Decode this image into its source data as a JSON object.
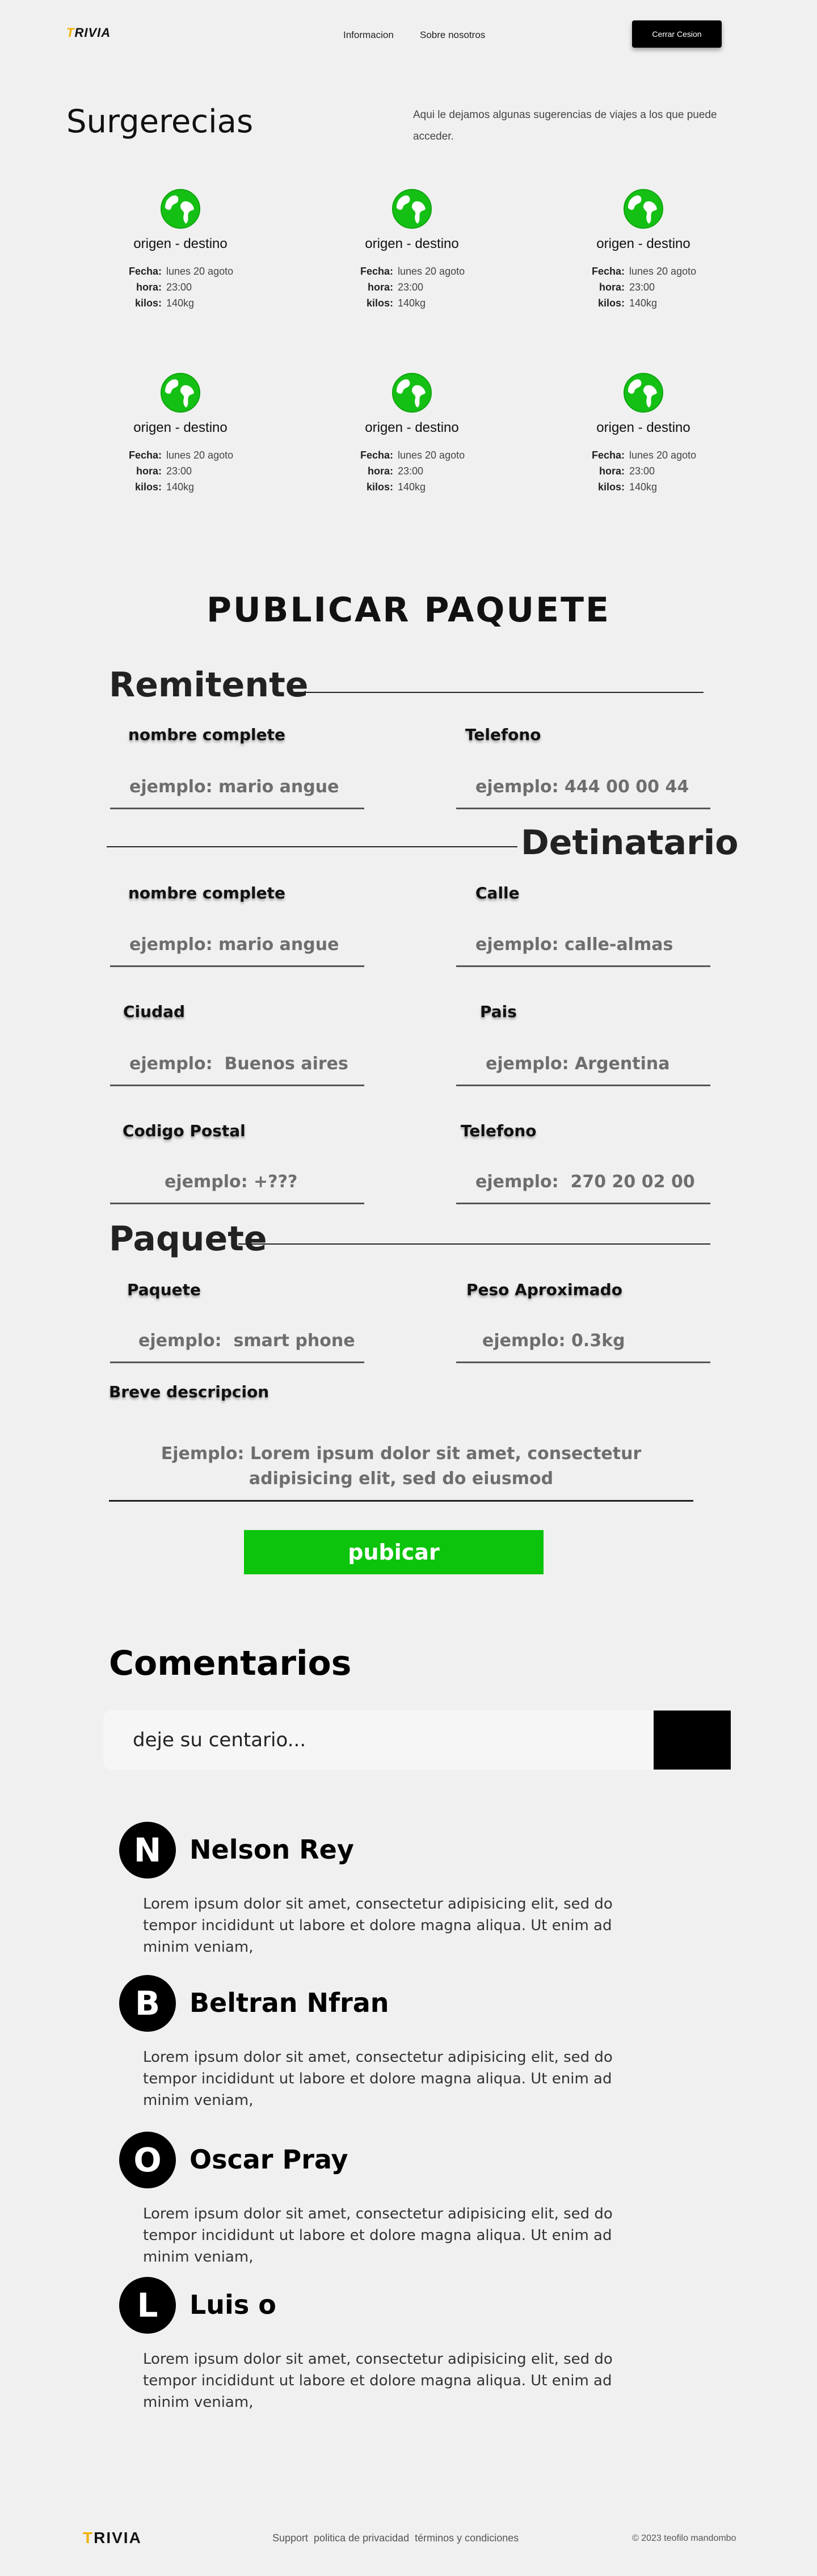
{
  "header": {
    "logo_first": "T",
    "logo_rest": "RIVIA",
    "nav": [
      "Informacion",
      "Sobre nosotros"
    ],
    "logout_label": "Cerrar Cesion"
  },
  "suggestions": {
    "title": "Surgerecias",
    "description": "Aqui le dejamos algunas sugerencias de viajes a los que puede acceder.",
    "labels": {
      "fecha": "Fecha:",
      "hora": "hora:",
      "kilos": "kilos:"
    },
    "cards": [
      {
        "title": "origen - destino",
        "fecha": "lunes 20 agoto",
        "hora": "23:00",
        "kilos": "140kg"
      },
      {
        "title": "origen - destino",
        "fecha": "lunes 20 agoto",
        "hora": "23:00",
        "kilos": "140kg"
      },
      {
        "title": "origen - destino",
        "fecha": "lunes 20 agoto",
        "hora": "23:00",
        "kilos": "140kg"
      },
      {
        "title": "origen - destino",
        "fecha": "lunes 20 agoto",
        "hora": "23:00",
        "kilos": "140kg"
      },
      {
        "title": "origen - destino",
        "fecha": "lunes 20 agoto",
        "hora": "23:00",
        "kilos": "140kg"
      },
      {
        "title": "origen - destino",
        "fecha": "lunes 20 agoto",
        "hora": "23:00",
        "kilos": "140kg"
      }
    ]
  },
  "publish": {
    "title": "PUBLICAR  PAQUETE",
    "remitente": {
      "title": "Remitente",
      "name_label": "nombre complete",
      "name_placeholder": "ejemplo: mario angue",
      "phone_label": "Telefono",
      "phone_placeholder": "ejemplo: 444 00 00 44"
    },
    "destinatario": {
      "title": "Detinatario",
      "name_label": "nombre complete",
      "name_placeholder": "ejemplo: mario angue",
      "street_label": "Calle",
      "street_placeholder": "ejemplo: calle-almas",
      "city_label": "Ciudad",
      "city_placeholder": "ejemplo:  Buenos aires",
      "country_label": "Pais",
      "country_placeholder": "ejemplo: Argentina",
      "postal_label": "Codigo Postal",
      "postal_placeholder": "ejemplo: +???",
      "phone_label": "Telefono",
      "phone_placeholder": "ejemplo:  270 20 02 00"
    },
    "paquete": {
      "title": "Paquete",
      "package_label": "Paquete",
      "package_placeholder": "ejemplo:  smart phone",
      "weight_label": "Peso Aproximado",
      "weight_placeholder": "ejemplo: 0.3kg",
      "desc_label": "Breve descripcion",
      "desc_placeholder": "Ejemplo: Lorem ipsum dolor sit amet, consectetur adipisicing elit, sed do eiusmod"
    },
    "submit_label": "pubicar"
  },
  "comments": {
    "title": "Comentarios",
    "input_placeholder": "deje su centario...",
    "items": [
      {
        "initial": "N",
        "name": "Nelson Rey",
        "text": "Lorem ipsum dolor sit amet, consectetur adipisicing elit, sed do tempor incididunt ut labore et dolore magna aliqua. Ut enim ad minim veniam,"
      },
      {
        "initial": "B",
        "name": "Beltran Nfran",
        "text": "Lorem ipsum dolor sit amet, consectetur adipisicing elit, sed do tempor incididunt ut labore et dolore magna aliqua. Ut enim ad minim veniam,"
      },
      {
        "initial": "O",
        "name": "Oscar Pray",
        "text": "Lorem ipsum dolor sit amet, consectetur adipisicing elit, sed do tempor incididunt ut labore et dolore magna aliqua. Ut enim ad minim veniam,"
      },
      {
        "initial": "L",
        "name": "Luis o",
        "text": "Lorem ipsum dolor sit amet, consectetur adipisicing elit, sed do tempor incididunt ut labore et dolore magna aliqua. Ut enim ad minim veniam,"
      }
    ]
  },
  "footer": {
    "logo_first": "T",
    "logo_rest": "RIVIA",
    "links": [
      "Support",
      "politica de privacidad",
      "términos y condiciones"
    ],
    "copyright": "© 2023 teofilo mandombo"
  },
  "colors": {
    "accent": "#0bc40b",
    "logo_accent": "#f2b100",
    "button_dark": "#000000"
  },
  "icons": {
    "card_icon": "globe-icon"
  }
}
